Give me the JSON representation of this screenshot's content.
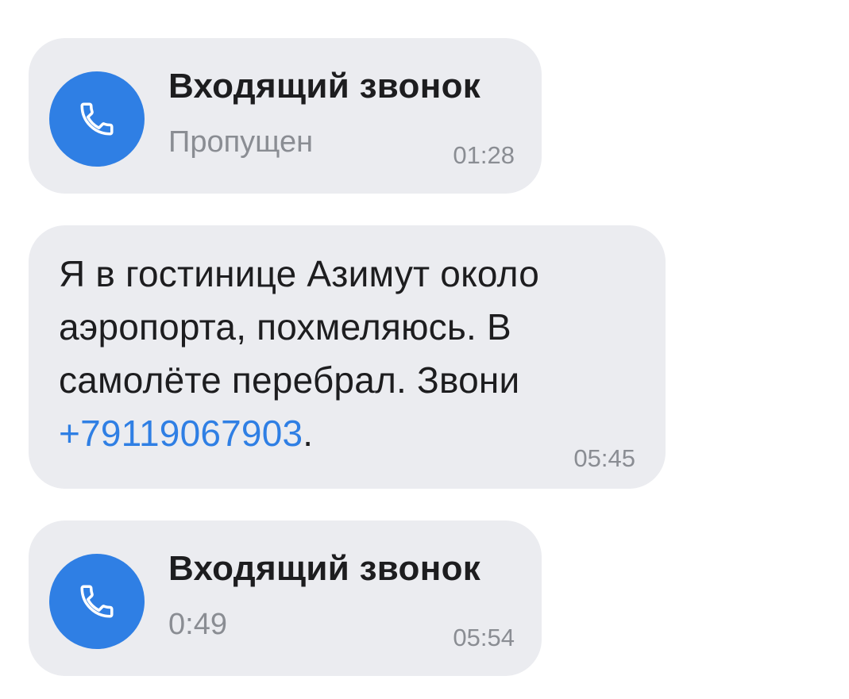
{
  "colors": {
    "bubble_bg": "#ebecf0",
    "accent": "#2f7fe4",
    "text_primary": "#1d1d1f",
    "text_secondary": "#8a8d93"
  },
  "messages": [
    {
      "type": "call",
      "icon": "phone-icon",
      "title": "Входящий звонок",
      "status": "Пропущен",
      "time": "01:28"
    },
    {
      "type": "text",
      "lines": [
        "Я в гостинице Азимут около",
        "аэропорта, похмеляюсь. В",
        "самолёте перебрал. Звони"
      ],
      "link": "+79119067903",
      "after_link": ".",
      "time": "05:45"
    },
    {
      "type": "call",
      "icon": "phone-icon",
      "title": "Входящий звонок",
      "status": "0:49",
      "time": "05:54"
    }
  ]
}
